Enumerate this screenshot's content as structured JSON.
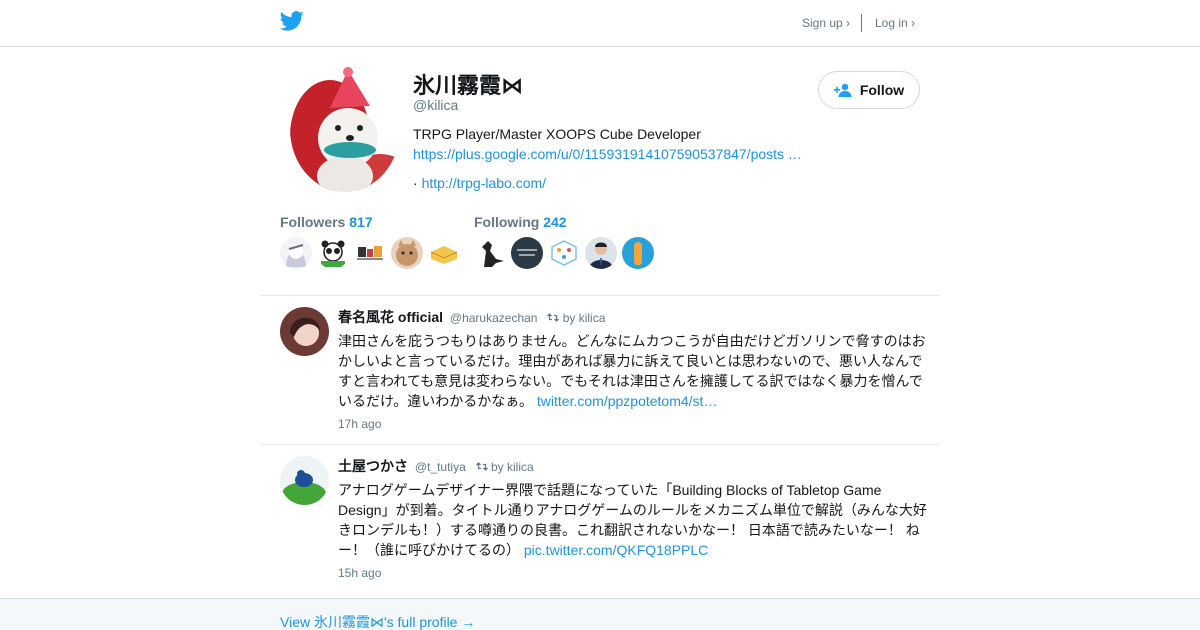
{
  "header": {
    "signup_label": "Sign up ›",
    "login_label": "Log in ›",
    "logo_icon": "twitter-bird-icon",
    "brand_color": "#1da1f2"
  },
  "profile": {
    "name": "氷川霧霞⋈",
    "handle": "@kilica",
    "bio": "TRPG Player/Master XOOPS Cube Developer",
    "bio_link": "https://plus.google.com/u/0/115931914107590537847/posts …",
    "website_prefix": "· ",
    "website": "http://trpg-labo.com/",
    "follow_label": "Follow"
  },
  "stats": {
    "followers_label": "Followers",
    "followers_count": "817",
    "following_label": "Following",
    "following_count": "242"
  },
  "tweets": [
    {
      "name": "春名風花 official",
      "handle": "@harukazechan",
      "retweet_by": "by kilica",
      "text": "津田さんを庇うつもりはありません。どんなにムカつこうが自由だけどガソリンで脅すのはおかしいよと言っているだけ。理由があれば暴力に訴えて良いとは思わないので、悪い人なんですと言われても意見は変わらない。でもそれは津田さんを擁護してる訳ではなく暴力を憎んでいるだけ。違いわかるかなぁ。",
      "link": "twitter.com/ppzpotetom4/st…",
      "time": "17h ago"
    },
    {
      "name": "土屋つかさ",
      "handle": "@t_tutiya",
      "retweet_by": "by kilica",
      "text": "アナログゲームデザイナー界隈で話題になっていた「Building Blocks of Tabletop Game Design」が到着。タイトル通りアナログゲームのルールをメカニズム単位で解説（みんな大好きロンデルも！）する噂通りの良書。これ翻訳されないかなー！ 日本語で読みたいなー！ ねー！（誰に呼びかけてるの） ",
      "link": "pic.twitter.com/QKFQ18PPLC",
      "time": "15h ago"
    }
  ],
  "footer": {
    "full_profile_label": "View 氷川霧霞⋈'s full profile →"
  },
  "colors": {
    "link": "#1b95e0",
    "muted": "#657786",
    "text": "#14171a",
    "border": "#e6ecf0"
  }
}
